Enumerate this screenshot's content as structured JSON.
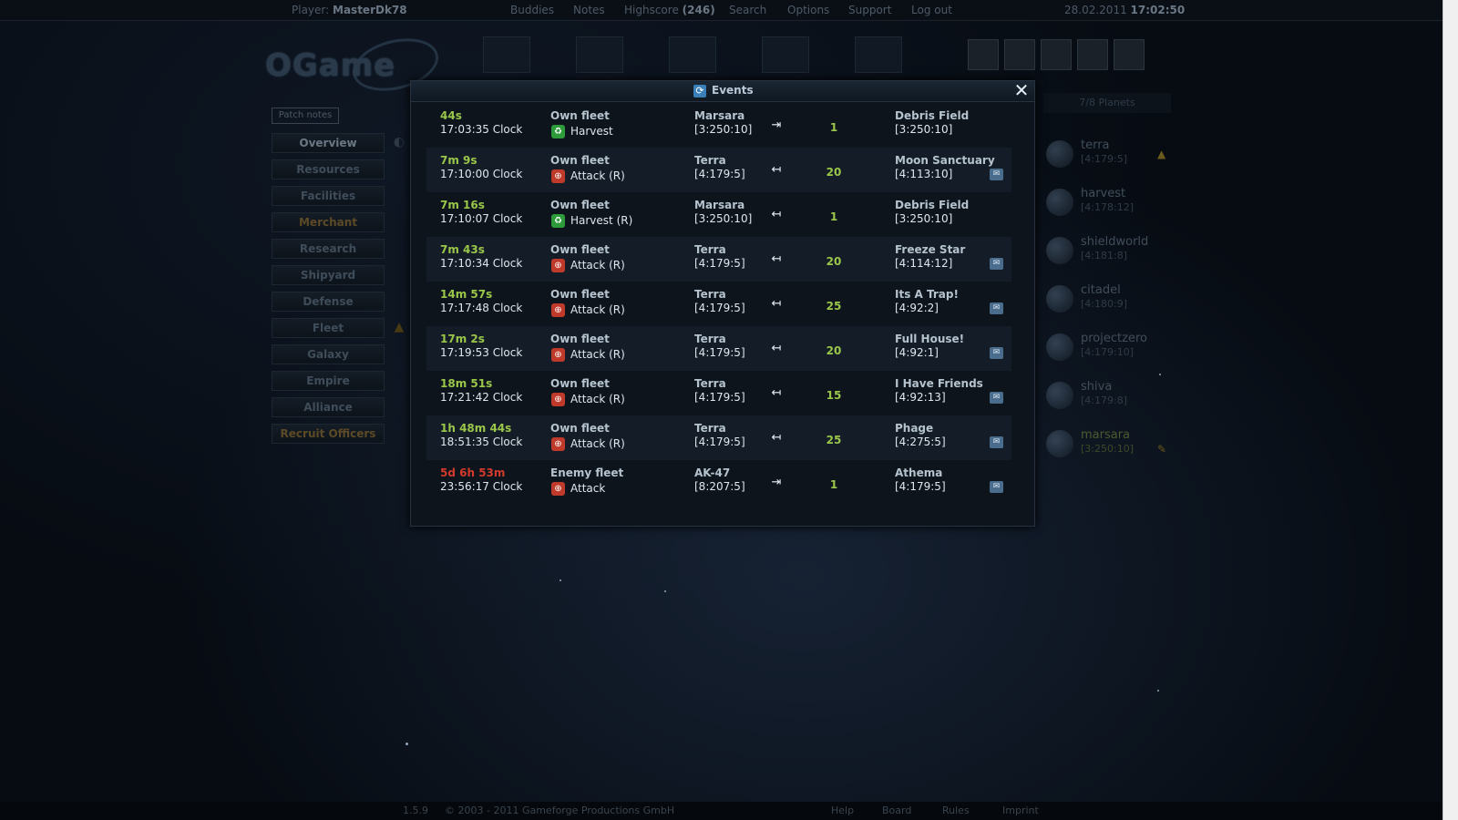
{
  "topbar": {
    "player_label": "Player:",
    "player_name": "MasterDk78",
    "nav": [
      "Buddies",
      "Notes",
      "Highscore",
      "Search",
      "Options",
      "Support",
      "Log out"
    ],
    "highscore_rank": "(246)",
    "date": "28.02.2011",
    "time": "17:02:50"
  },
  "logo": "OGame",
  "left_menu": {
    "patch_notes": "Patch notes",
    "items": [
      "Overview",
      "Resources",
      "Facilities",
      "Merchant",
      "Research",
      "Shipyard",
      "Defense",
      "Fleet",
      "Galaxy",
      "Empire",
      "Alliance",
      "Recruit Officers"
    ]
  },
  "planets": {
    "header": "7/8 Planets",
    "list": [
      {
        "name": "terra",
        "coord": "[4:179:5]"
      },
      {
        "name": "harvest",
        "coord": "[4:178:12]"
      },
      {
        "name": "shieldworld",
        "coord": "[4:181:8]"
      },
      {
        "name": "citadel",
        "coord": "[4:180:9]"
      },
      {
        "name": "projectzero",
        "coord": "[4:179:10]"
      },
      {
        "name": "shiva",
        "coord": "[4:179:8]"
      },
      {
        "name": "marsara",
        "coord": "[3:250:10]"
      }
    ]
  },
  "events": {
    "title": "Events",
    "rows": [
      {
        "countdown": "44s",
        "clock": "17:03:35 Clock",
        "fleet": "Own fleet",
        "mission": "Harvest",
        "mission_type": "harvest",
        "origin": "Marsara",
        "origin_coord": "[3:250:10]",
        "direction": "outgoing",
        "ships": "1",
        "dest": "Debris Field",
        "dest_coord": "[3:250:10]",
        "message": false
      },
      {
        "countdown": "7m 9s",
        "clock": "17:10:00 Clock",
        "fleet": "Own fleet",
        "mission": "Attack (R)",
        "mission_type": "attack",
        "origin": "Terra",
        "origin_coord": "[4:179:5]",
        "direction": "return",
        "ships": "20",
        "dest": "Moon Sanctuary",
        "dest_coord": "[4:113:10]",
        "message": true
      },
      {
        "countdown": "7m 16s",
        "clock": "17:10:07 Clock",
        "fleet": "Own fleet",
        "mission": "Harvest (R)",
        "mission_type": "harvest",
        "origin": "Marsara",
        "origin_coord": "[3:250:10]",
        "direction": "return",
        "ships": "1",
        "dest": "Debris Field",
        "dest_coord": "[3:250:10]",
        "message": false
      },
      {
        "countdown": "7m 43s",
        "clock": "17:10:34 Clock",
        "fleet": "Own fleet",
        "mission": "Attack (R)",
        "mission_type": "attack",
        "origin": "Terra",
        "origin_coord": "[4:179:5]",
        "direction": "return",
        "ships": "20",
        "dest": "Freeze Star",
        "dest_coord": "[4:114:12]",
        "message": true
      },
      {
        "countdown": "14m 57s",
        "clock": "17:17:48 Clock",
        "fleet": "Own fleet",
        "mission": "Attack (R)",
        "mission_type": "attack",
        "origin": "Terra",
        "origin_coord": "[4:179:5]",
        "direction": "return",
        "ships": "25",
        "dest": "Its A Trap!",
        "dest_coord": "[4:92:2]",
        "message": true
      },
      {
        "countdown": "17m 2s",
        "clock": "17:19:53 Clock",
        "fleet": "Own fleet",
        "mission": "Attack (R)",
        "mission_type": "attack",
        "origin": "Terra",
        "origin_coord": "[4:179:5]",
        "direction": "return",
        "ships": "20",
        "dest": "Full House!",
        "dest_coord": "[4:92:1]",
        "message": true
      },
      {
        "countdown": "18m 51s",
        "clock": "17:21:42 Clock",
        "fleet": "Own fleet",
        "mission": "Attack (R)",
        "mission_type": "attack",
        "origin": "Terra",
        "origin_coord": "[4:179:5]",
        "direction": "return",
        "ships": "15",
        "dest": "I Have Friends",
        "dest_coord": "[4:92:13]",
        "message": true
      },
      {
        "countdown": "1h 48m 44s",
        "clock": "18:51:35 Clock",
        "fleet": "Own fleet",
        "mission": "Attack (R)",
        "mission_type": "attack",
        "origin": "Terra",
        "origin_coord": "[4:179:5]",
        "direction": "return",
        "ships": "25",
        "dest": "Phage",
        "dest_coord": "[4:275:5]",
        "message": true
      },
      {
        "countdown": "5d 6h 53m",
        "clock": "23:56:17 Clock",
        "fleet": "Enemy fleet",
        "mission": "Attack",
        "mission_type": "attack",
        "origin": "AK-47",
        "origin_coord": "[8:207:5]",
        "direction": "outgoing",
        "ships": "1",
        "dest": "Athema",
        "dest_coord": "[4:179:5]",
        "message": true,
        "enemy": true
      }
    ]
  },
  "footer": {
    "version": "1.5.9",
    "copyright": "© 2003 - 2011 Gameforge Productions GmbH",
    "links": [
      "Help",
      "Board",
      "Rules",
      "Imprint"
    ]
  },
  "colors": {
    "own_countdown": "#9ac64a",
    "enemy_countdown": "#d33a2c",
    "harvest_icon": "#2e9b3a",
    "attack_icon": "#c03a2c"
  }
}
